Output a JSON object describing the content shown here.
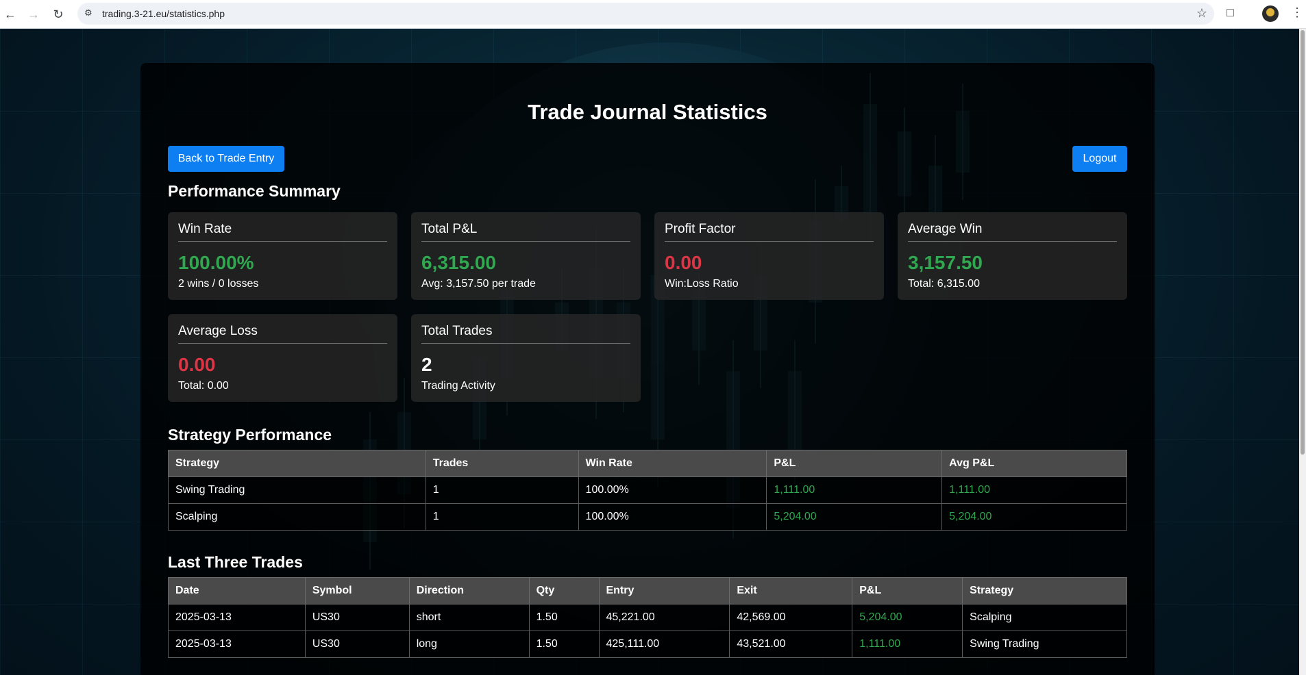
{
  "browser": {
    "url": "trading.3-21.eu/statistics.php"
  },
  "page": {
    "title": "Trade Journal Statistics",
    "back_button": "Back to Trade Entry",
    "logout_button": "Logout",
    "performance_heading": "Performance Summary",
    "strategy_heading": "Strategy Performance",
    "trades_heading": "Last Three Trades"
  },
  "cards": [
    {
      "title": "Win Rate",
      "value": "100.00%",
      "sub": "2 wins / 0 losses",
      "color": "#2fa84f"
    },
    {
      "title": "Total P&L",
      "value": "6,315.00",
      "sub": "Avg: 3,157.50 per trade",
      "color": "#2fa84f"
    },
    {
      "title": "Profit Factor",
      "value": "0.00",
      "sub": "Win:Loss Ratio",
      "color": "#dc3545"
    },
    {
      "title": "Average Win",
      "value": "3,157.50",
      "sub": "Total: 6,315.00",
      "color": "#2fa84f"
    },
    {
      "title": "Average Loss",
      "value": "0.00",
      "sub": "Total: 0.00",
      "color": "#dc3545"
    },
    {
      "title": "Total Trades",
      "value": "2",
      "sub": "Trading Activity",
      "color": "#ffffff"
    }
  ],
  "strategy_table": {
    "headers": [
      "Strategy",
      "Trades",
      "Win Rate",
      "P&L",
      "Avg P&L"
    ],
    "rows": [
      [
        "Swing Trading",
        "1",
        "100.00%",
        "1,111.00",
        "1,111.00"
      ],
      [
        "Scalping",
        "1",
        "100.00%",
        "5,204.00",
        "5,204.00"
      ]
    ]
  },
  "trades_table": {
    "headers": [
      "Date",
      "Symbol",
      "Direction",
      "Qty",
      "Entry",
      "Exit",
      "P&L",
      "Strategy"
    ],
    "rows": [
      [
        "2025-03-13",
        "US30",
        "short",
        "1.50",
        "45,221.00",
        "42,569.00",
        "5,204.00",
        "Scalping"
      ],
      [
        "2025-03-13",
        "US30",
        "long",
        "1.50",
        "425,111.00",
        "43,521.00",
        "1,111.00",
        "Swing Trading"
      ]
    ]
  }
}
